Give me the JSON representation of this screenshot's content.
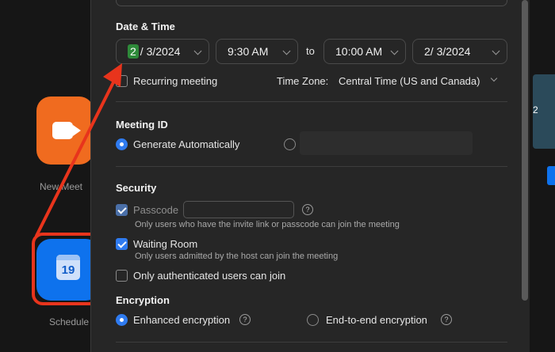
{
  "background": {
    "new_meeting_label": "New Meet",
    "schedule_label": "Schedule",
    "calendar_day": "19",
    "right_thumb_digit": "2"
  },
  "date_time": {
    "title": "Date & Time",
    "start_date_month_highlight": "2",
    "start_date_rest": "/  3/2024",
    "start_time": "9:30 AM",
    "to_label": "to",
    "end_time": "10:00 AM",
    "end_date": "2/  3/2024",
    "recurring_label": "Recurring meeting",
    "timezone_label": "Time Zone:",
    "timezone_value": "Central Time (US and Canada)"
  },
  "meeting_id": {
    "title": "Meeting ID",
    "generate_label": "Generate Automatically"
  },
  "security": {
    "title": "Security",
    "passcode_label": "Passcode",
    "passcode_help": "?",
    "passcode_note": "Only users who have the invite link or passcode can join the meeting",
    "waiting_room_label": "Waiting Room",
    "waiting_room_note": "Only users admitted by the host can join the meeting",
    "auth_label": "Only authenticated users can join"
  },
  "encryption": {
    "title": "Encryption",
    "enhanced_label": "Enhanced encryption",
    "e2e_label": "End-to-end encryption",
    "help": "?"
  },
  "colors": {
    "accent": "#2f7bf0",
    "annotation": "#e8341c",
    "highlight": "#2e8a3a"
  }
}
